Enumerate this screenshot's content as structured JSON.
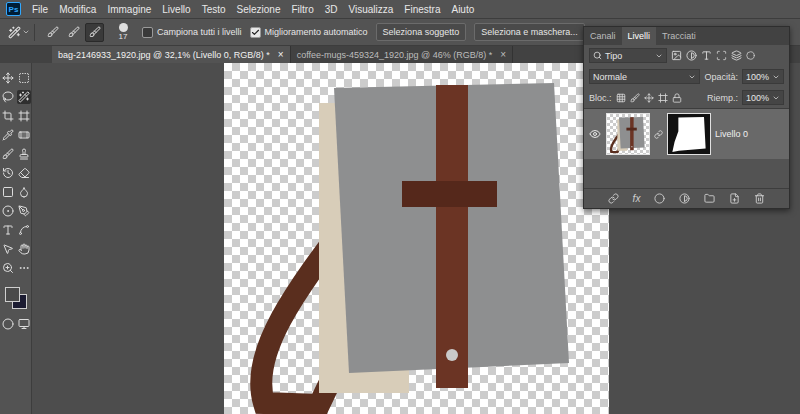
{
  "logo": "Ps",
  "menu": [
    "File",
    "Modifica",
    "Immagine",
    "Livello",
    "Testo",
    "Selezione",
    "Filtro",
    "3D",
    "Visualizza",
    "Finestra",
    "Aiuto"
  ],
  "options": {
    "modes": [
      {
        "selected": false
      },
      {
        "selected": false
      },
      {
        "selected": true
      }
    ],
    "brush_size": "17",
    "checkboxes": [
      {
        "label": "Campiona tutti i livelli",
        "checked": false
      },
      {
        "label": "Miglioramento automatico",
        "checked": true
      }
    ],
    "buttons": [
      "Seleziona soggetto",
      "Seleziona e maschera..."
    ]
  },
  "tabs": [
    {
      "label": "bag-2146933_1920.jpg @ 32,1% (Livello 0, RGB/8) *",
      "close": "×",
      "selected": true
    },
    {
      "label": "coffee-mugs-459324_1920.jpg @ 46% (RGB/8) *",
      "close": "×",
      "selected": false
    }
  ],
  "tools": [
    {
      "selected": false
    },
    {
      "selected": false
    },
    {
      "selected": false
    },
    {
      "selected": true
    },
    {
      "selected": false
    },
    {
      "selected": false
    },
    {
      "selected": false
    },
    {
      "selected": false
    },
    {
      "selected": false
    },
    {
      "selected": false
    },
    {
      "selected": false
    },
    {
      "selected": false
    },
    {
      "selected": false
    },
    {
      "selected": false
    },
    {
      "selected": false
    },
    {
      "selected": false
    },
    {
      "selected": false
    },
    {
      "selected": false
    },
    {
      "selected": false
    },
    {
      "selected": false
    },
    {
      "selected": false
    },
    {
      "selected": false
    },
    {
      "selected": false
    },
    {
      "selected": false
    }
  ],
  "swatches": [
    {
      "color": "#4a4a4a"
    },
    {
      "color": "#1c1c32"
    }
  ],
  "layers_panel": {
    "tabs": [
      {
        "label": "Canali",
        "selected": false
      },
      {
        "label": "Livelli",
        "selected": true
      },
      {
        "label": "Tracciati",
        "selected": false
      }
    ],
    "filter": "Tipo",
    "blend_mode": "Normale",
    "opacity_label": "Opacità:",
    "opacity": "100%",
    "lock_label": "Bloc.:",
    "fill_label": "Riemp.:",
    "fill": "100%",
    "layers": [
      {
        "name": "Livello 0",
        "selected": true,
        "visible": true,
        "mask": true
      }
    ],
    "effects_label": "fx"
  }
}
